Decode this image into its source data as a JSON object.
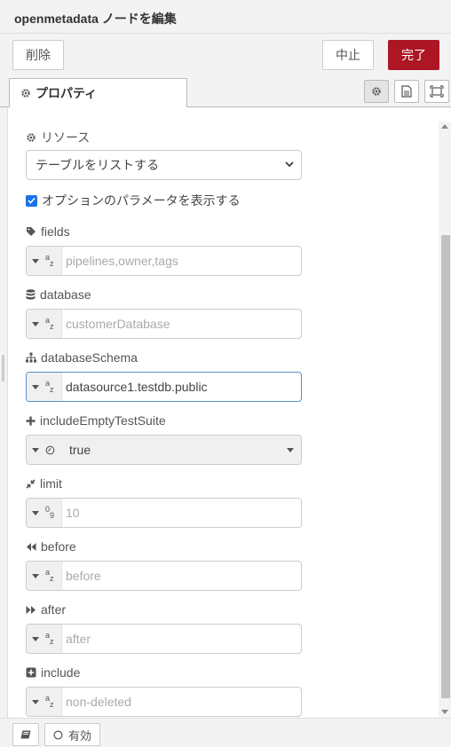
{
  "window": {
    "title": "openmetadata ノードを編集"
  },
  "actions": {
    "delete_label": "削除",
    "cancel_label": "中止",
    "done_label": "完了"
  },
  "tabs": {
    "properties_label": "プロパティ"
  },
  "resource": {
    "label": "リソース",
    "selected": "テーブルをリストする"
  },
  "optional": {
    "label": "オプションのパラメータを表示する",
    "checked": true
  },
  "fields": [
    {
      "label": "fields",
      "type": "az",
      "placeholder": "pipelines,owner,tags",
      "value": ""
    },
    {
      "label": "database",
      "type": "az",
      "placeholder": "customerDatabase",
      "value": ""
    },
    {
      "label": "databaseSchema",
      "type": "az",
      "placeholder": "",
      "value": "datasource1.testdb.public"
    },
    {
      "label": "includeEmptyTestSuite",
      "type": "bool",
      "placeholder": "",
      "value": "true"
    },
    {
      "label": "limit",
      "type": "09",
      "placeholder": "10",
      "value": ""
    },
    {
      "label": "before",
      "type": "az",
      "placeholder": "before",
      "value": ""
    },
    {
      "label": "after",
      "type": "az",
      "placeholder": "after",
      "value": ""
    },
    {
      "label": "include",
      "type": "az",
      "placeholder": "non-deleted",
      "value": ""
    }
  ],
  "footer": {
    "status_label": "有効"
  },
  "colors": {
    "primary": "#ad1625",
    "checkbox": "#1a73e8",
    "focus": "#5b8ec9"
  }
}
